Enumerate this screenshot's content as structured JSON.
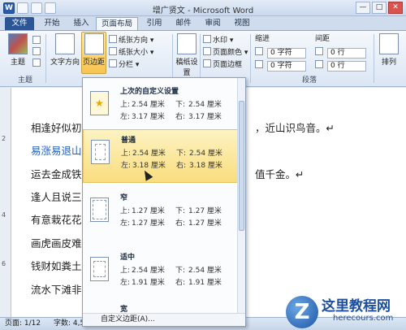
{
  "window": {
    "title": "增广贤文 - Microsoft Word",
    "min": "—",
    "max": "□",
    "close": "✕"
  },
  "tabs": [
    "文件",
    "开始",
    "插入",
    "页面布局",
    "引用",
    "邮件",
    "审阅",
    "视图"
  ],
  "ribbon": {
    "theme_label": "主题",
    "text_direction_label": "文字方向",
    "margins_label": "页边距",
    "orientation_label": "纸张方向 ▾",
    "size_label": "纸张大小 ▾",
    "columns_label": "分栏 ▾",
    "manuscript_label": "稿纸设置",
    "watermark_label": "水印 ▾",
    "page_color_label": "页面颜色 ▾",
    "page_border_label": "页面边框",
    "indent_label": "缩进",
    "spacing_label": "间距",
    "indent_left": "0 字符",
    "indent_right": "0 字符",
    "spacing_before": "0 行",
    "spacing_after": "0 行",
    "arrange_label": "排列",
    "group_theme": "主题",
    "group_paragraph": "段落"
  },
  "document": {
    "lines": [
      "相逢好似初",
      "易涨易退山",
      "运去金成铁",
      "逢人且说三",
      "有意栽花花",
      "画虎画皮难",
      "钱财如粪土",
      "流水下滩非"
    ],
    "right_fragments": [
      "，近山识鸟音。↵",
      "值千金。↵"
    ]
  },
  "dropdown": {
    "options": [
      {
        "title": "上次的自定义设置",
        "top_k": "上:",
        "top": "2.54 厘米",
        "bottom_k": "下:",
        "bottom": "2.54 厘米",
        "left_k": "左:",
        "left": "3.17 厘米",
        "right_k": "右:",
        "right": "3.17 厘米"
      },
      {
        "title": "普通",
        "top_k": "上:",
        "top": "2.54 厘米",
        "bottom_k": "下:",
        "bottom": "2.54 厘米",
        "left_k": "左:",
        "left": "3.18 厘米",
        "right_k": "右:",
        "right": "3.18 厘米"
      },
      {
        "title": "窄",
        "top_k": "上:",
        "top": "1.27 厘米",
        "bottom_k": "下:",
        "bottom": "1.27 厘米",
        "left_k": "左:",
        "left": "1.27 厘米",
        "right_k": "右:",
        "right": "1.27 厘米"
      },
      {
        "title": "适中",
        "top_k": "上:",
        "top": "2.54 厘米",
        "bottom_k": "下:",
        "bottom": "2.54 厘米",
        "left_k": "左:",
        "left": "1.91 厘米",
        "right_k": "右:",
        "right": "1.91 厘米"
      },
      {
        "title": "宽"
      }
    ],
    "footer": "自定义边距(A)..."
  },
  "status": {
    "page": "页面: 1/12",
    "words": "字数: 4,52"
  },
  "watermark": {
    "logo_letter": "Z",
    "title": "这里教程网",
    "url": "herecours.com"
  },
  "colors": {
    "file_tab": "#2b5797",
    "highlight": "#f9dd7e",
    "link_blue": "#2a5fb8"
  }
}
